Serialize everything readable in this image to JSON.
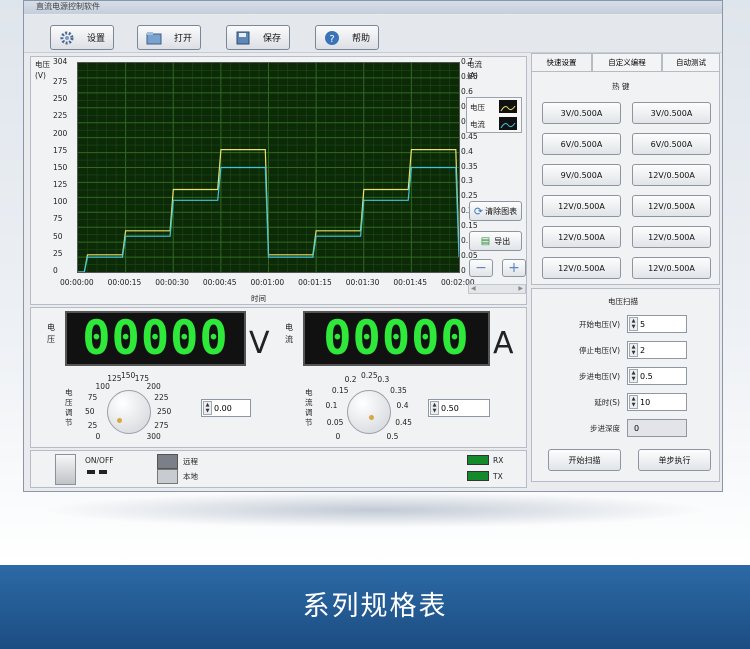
{
  "window_title": "直流电源控制软件",
  "toolbar": {
    "buttons": [
      "设置",
      "打开",
      "保存",
      "帮助"
    ]
  },
  "chart": {
    "left_axis_label": "电压\n(V)",
    "right_axis_label": "电流\n(A)",
    "xlabel": "时间",
    "legend": [
      {
        "name": "电压",
        "color": "#e8e26a"
      },
      {
        "name": "电流",
        "color": "#41c7d9"
      }
    ],
    "left_ticks": [
      "304",
      "275",
      "250",
      "225",
      "200",
      "175",
      "150",
      "125",
      "100",
      "75",
      "50",
      "25",
      "0"
    ],
    "right_ticks": [
      "0.7",
      "0.65",
      "0.6",
      "0.55",
      "0.5",
      "0.45",
      "0.4",
      "0.35",
      "0.3",
      "0.25",
      "0.2",
      "0.15",
      "0.1",
      "0.05",
      "0"
    ],
    "x_ticks": [
      "00:00:00",
      "00:00:15",
      "00:00:30",
      "00:00:45",
      "00:01:00",
      "00:01:15",
      "00:01:30",
      "00:01:45",
      "00:02:00"
    ],
    "clear_label": "清除图表",
    "export_label": "导出"
  },
  "chart_data": {
    "type": "line",
    "xlabel": "时间",
    "ylabel": "电压 (V)",
    "y2label": "电流 (A)",
    "ylim": [
      0,
      304
    ],
    "y2lim": [
      0,
      0.7
    ],
    "x": [
      0,
      2,
      3,
      14,
      15,
      29,
      30,
      44,
      45,
      59,
      60,
      74,
      75,
      89,
      90,
      104,
      105,
      119,
      120
    ],
    "series": [
      {
        "name": "电压",
        "color": "#e8e26a",
        "values": [
          0,
          0,
          25,
          25,
          60,
          60,
          120,
          120,
          178,
          178,
          25,
          25,
          60,
          60,
          120,
          120,
          178,
          178,
          30
        ]
      },
      {
        "name": "电流",
        "color": "#41c7d9",
        "values": [
          0,
          0,
          0.05,
          0.05,
          0.12,
          0.12,
          0.24,
          0.24,
          0.35,
          0.35,
          0.05,
          0.05,
          0.12,
          0.12,
          0.24,
          0.24,
          0.35,
          0.35,
          0.05
        ]
      }
    ],
    "grid": true
  },
  "voltage_display": {
    "label": "电\n压",
    "value": "00000",
    "unit": "V"
  },
  "current_display": {
    "label": "电\n流",
    "value": "00000",
    "unit": "A"
  },
  "voltage_knob": {
    "label": "电\n压\n调\n节",
    "ticks": [
      "0",
      "25",
      "50",
      "75",
      "100",
      "125",
      "150",
      "175",
      "200",
      "225",
      "250",
      "275",
      "300"
    ],
    "value": "0.00"
  },
  "current_knob": {
    "label": "电\n流\n调\n节",
    "ticks": [
      "0",
      "0.05",
      "0.1",
      "0.15",
      "0.2",
      "0.25",
      "0.3",
      "0.35",
      "0.4",
      "0.45",
      "0.5"
    ],
    "value": "0.50"
  },
  "status": {
    "onoff": "ON/OFF",
    "remote": "远程",
    "local": "本地",
    "rx": "RX",
    "tx": "TX"
  },
  "tabs": [
    "快速设置",
    "自定义编程",
    "自动测试"
  ],
  "hotkeys": {
    "title": "热 键",
    "buttons": [
      "3V/0.500A",
      "3V/0.500A",
      "6V/0.500A",
      "6V/0.500A",
      "9V/0.500A",
      "12V/0.500A",
      "12V/0.500A",
      "12V/0.500A",
      "12V/0.500A",
      "12V/0.500A",
      "12V/0.500A",
      "12V/0.500A"
    ]
  },
  "scan": {
    "title": "电压扫描",
    "fields": [
      {
        "label": "开始电压(V)",
        "value": "5"
      },
      {
        "label": "停止电压(V)",
        "value": "2"
      },
      {
        "label": "步进电压(V)",
        "value": "0.5"
      },
      {
        "label": "延时(S)",
        "value": "10"
      },
      {
        "label": "步进深度",
        "value": "0"
      }
    ],
    "start_button": "开始扫描",
    "step_button": "单步执行"
  },
  "banner": "系列规格表"
}
